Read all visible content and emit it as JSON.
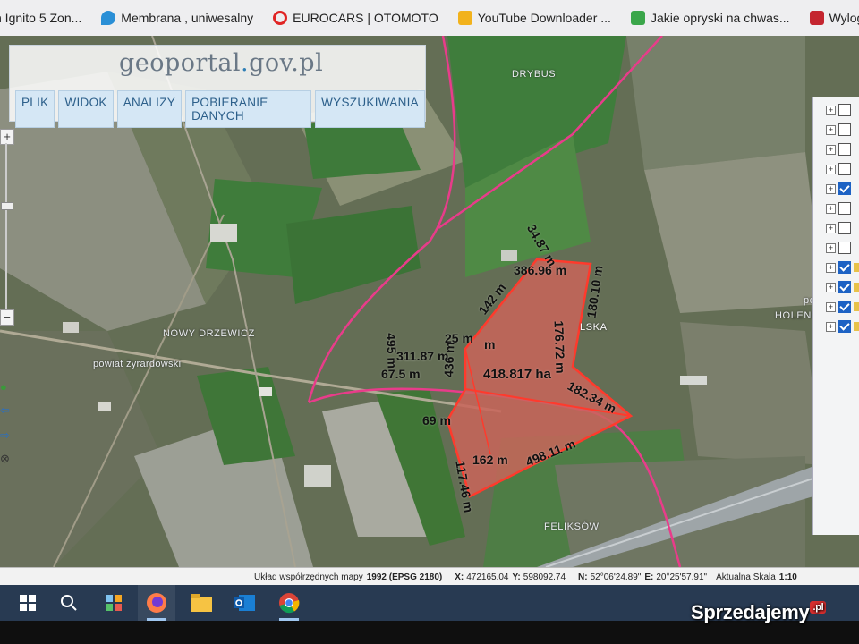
{
  "browser": {
    "bookmarks": [
      {
        "label": "n Ignito 5 Zon...",
        "icon": "generic-site-icon",
        "color": "#777777"
      },
      {
        "label": "Membrana , uniwesalny",
        "icon": "water-drop-icon",
        "color": "#2a8fd6"
      },
      {
        "label": "EUROCARS | OTOMOTO",
        "icon": "otomoto-logo-icon",
        "color": "#e02424"
      },
      {
        "label": "YouTube Downloader ...",
        "icon": "youtube-downloader-icon",
        "color": "#f2b21c"
      },
      {
        "label": "Jakie opryski na chwas...",
        "icon": "leaf-icon",
        "color": "#3aa64a"
      },
      {
        "label": "Wylogowano",
        "icon": "site-logo-icon",
        "color": "#c4252f"
      }
    ]
  },
  "geoportal": {
    "logo": {
      "part1": "geoportal",
      "dot": ".",
      "part2": "gov.pl"
    },
    "menu": [
      "PLIK",
      "WIDOK",
      "ANALIZY",
      "POBIERANIE DANYCH",
      "WYSZUKIWANIA"
    ]
  },
  "map": {
    "place_labels": [
      "DRYBUS",
      "NOWY DRZEWICZ",
      "powiat żyrardowski",
      "HOLENDRY",
      "FELIKSÓW",
      "LSKA",
      "powi"
    ],
    "area_label": "418.817 ha",
    "measurements": [
      "498.11 m",
      "182.34 m",
      "176.72 m",
      "180.10 m",
      "386.96 m",
      "34.87 m",
      "142 m",
      "25 m",
      "311.87 m",
      "495 m",
      "67.5 m",
      "69 m",
      "117.46 m",
      "162 m",
      "436 m",
      "m"
    ]
  },
  "zoom": {
    "plus": "+",
    "minus": "−"
  },
  "layers": {
    "rows": [
      {
        "checked": false,
        "folder": false
      },
      {
        "checked": false,
        "folder": false
      },
      {
        "checked": false,
        "folder": false
      },
      {
        "checked": false,
        "folder": false
      },
      {
        "checked": true,
        "folder": false
      },
      {
        "checked": false,
        "folder": false
      },
      {
        "checked": false,
        "folder": false
      },
      {
        "checked": false,
        "folder": false
      },
      {
        "checked": true,
        "folder": true
      },
      {
        "checked": true,
        "folder": true
      },
      {
        "checked": true,
        "folder": true
      },
      {
        "checked": true,
        "folder": true
      }
    ]
  },
  "status": {
    "crs_label": "Układ współrzędnych mapy",
    "crs_value": "1992 (EPSG 2180)",
    "x_label": "X:",
    "x_value": "472165.04",
    "y_label": "Y:",
    "y_value": "598092.74",
    "n_label": "N:",
    "n_value": "52°06'24.89\"",
    "e_label": "E:",
    "e_value": "20°25'57.91\"",
    "scale_label": "Aktualna Skala",
    "scale_value": "1:10"
  },
  "taskbar": {
    "apps": [
      "windows-start-icon",
      "search-icon",
      "taskview-icon",
      "firefox-icon",
      "file-explorer-icon",
      "outlook-icon",
      "chrome-icon"
    ]
  },
  "watermark": {
    "text": "Sprzedajemy",
    "suffix": ".pl"
  },
  "colors": {
    "parcel_fill": "#c9655a",
    "parcel_border": "#ff3a2c",
    "boundary": "#e83c8a",
    "menu_text": "#2c5f8a"
  }
}
